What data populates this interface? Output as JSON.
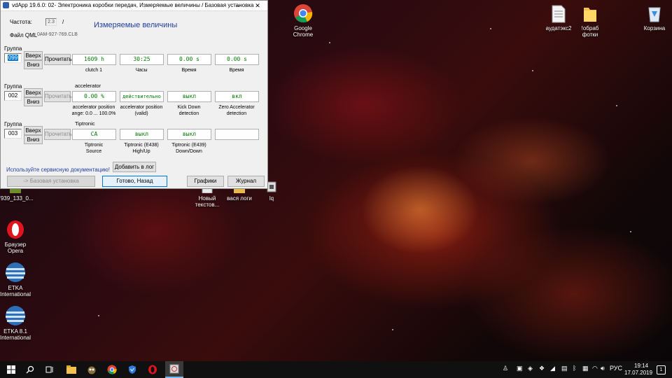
{
  "window": {
    "title": "vdApp 19.6.0: 02- Электроника коробки передач,  Измеряемые величины / Базовая установка",
    "minimize": "–",
    "close": "✕"
  },
  "header": {
    "freq_label": "Частота:",
    "freq_value": "2.3",
    "freq_sep": "/",
    "qml_label": "Файл QML",
    "qml_value": "0AM-927-769.CLB",
    "heading": "Измеряемые величины"
  },
  "groups": [
    {
      "label": "Группа",
      "number": "099",
      "up": "Вверх",
      "down": "Вниз",
      "read": "Прочитать",
      "title": "",
      "values": [
        "1609 h",
        "30:25",
        "0.00 s",
        "0.00 s"
      ],
      "captions": [
        "clutch 1",
        "Часы",
        "Время",
        "Время"
      ]
    },
    {
      "label": "Группа",
      "number": "002",
      "up": "Вверх",
      "down": "Вниз",
      "read": "Прочитать",
      "title": "accelerator",
      "values": [
        "0.00 %",
        "действительно",
        "выкл",
        "вкл"
      ],
      "captions": [
        "accelerator position\nange: 0.0 ... 100.0%",
        "accelerator position\n(valid)",
        "Kick Down\ndetection",
        "Zero Accelerator\ndetection"
      ]
    },
    {
      "label": "Группа",
      "number": "003",
      "up": "Вверх",
      "down": "Вниз",
      "read": "Прочитать",
      "title": "Tiptronic",
      "values": [
        "CA",
        "выкл",
        "выкл",
        ""
      ],
      "captions": [
        "Tiptronic\nSource",
        "Tiptronic (E438)\nHigh/Up",
        "Tiptronic (E439)\nDown/Down",
        ""
      ]
    }
  ],
  "footer": {
    "service_doc": "Используйте сервисную документацию!",
    "add_log": "Добавить в лог",
    "basic_settings": "-> Базовая установка",
    "done_back": "Готово, Назад",
    "graphs": "Графики",
    "journal": "Журнал"
  },
  "desktop_icons": [
    {
      "label": "Google\nChrome",
      "icon": "chrome-icon"
    },
    {
      "label": "аудатэкс2",
      "icon": "document-icon"
    },
    {
      "label": "!обраб\nфотки",
      "icon": "folder-icon"
    },
    {
      "label": "Корзина",
      "icon": "recycle-bin-icon"
    },
    {
      "label": "7939_133_0...",
      "icon": "image-file-icon"
    },
    {
      "label": "Новый\nтекстов...",
      "icon": "text-file-icon"
    },
    {
      "label": "вася логи",
      "icon": "folder-icon"
    },
    {
      "label": "lq",
      "icon": "app-icon"
    },
    {
      "label": "Браузер\nOpera",
      "icon": "opera-icon"
    },
    {
      "label": "ETKA\nInternational",
      "icon": "etka-icon"
    },
    {
      "label": "ETKA 8.1\nInternational",
      "icon": "etka-icon"
    }
  ],
  "taskbar": {
    "language": "РУС",
    "time": "19:14",
    "date": "17.07.2019",
    "notifications": "1",
    "apps": [
      "start-icon",
      "search-icon",
      "task-view-icon",
      "file-explorer-icon",
      "gimp-icon",
      "chrome-icon",
      "vpn-icon",
      "opera-icon",
      "vdapp-icon"
    ]
  },
  "colors": {
    "value_text": "#007a00",
    "heading": "#1f3da0",
    "taskbar": "#101010",
    "selected_number": "#0078d7"
  }
}
